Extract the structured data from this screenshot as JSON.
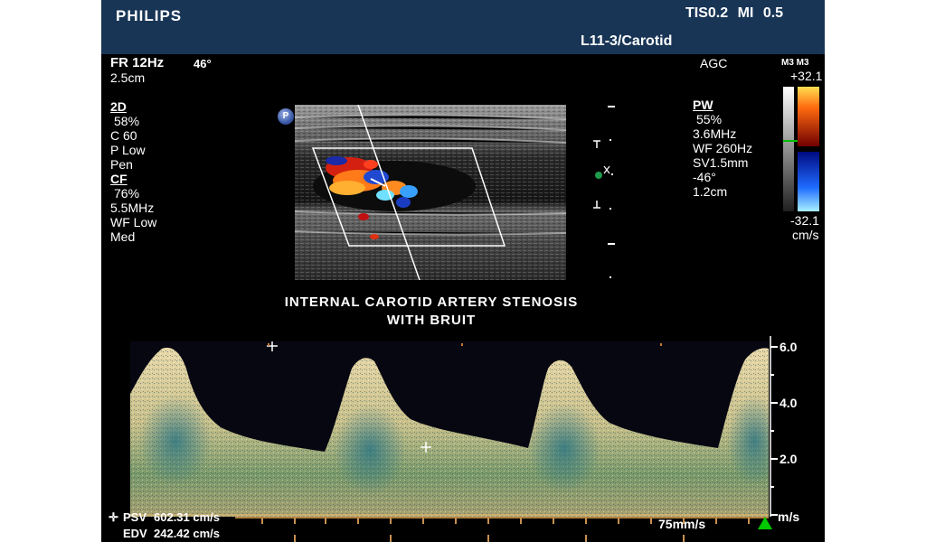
{
  "header": {
    "brand": "PHILIPS",
    "tis": "TIS0.2",
    "mi": "MI 0.5",
    "probe_preset": "L11-3/Carotid"
  },
  "left_panel": {
    "frame_rate": "FR 12Hz",
    "angle": "46°",
    "depth": "2.5cm",
    "mode_2d_title": "2D",
    "mode_2d": [
      "58%",
      "C 60",
      "P Low",
      "Pen"
    ],
    "mode_cf_title": "CF",
    "mode_cf": [
      "76%",
      "5.5MHz",
      "WF Low",
      "Med"
    ]
  },
  "right_panel": {
    "agc": "AGC",
    "pw_title": "PW",
    "pw": [
      "55%",
      "3.6MHz",
      "WF 260Hz",
      "SV1.5mm",
      "-46°",
      "1.2cm"
    ]
  },
  "colorbar": {
    "header": "M3 M3",
    "top_value": "+32.1",
    "bottom_value": "-32.1",
    "unit": "cm/s"
  },
  "image": {
    "badge": "P",
    "caption_line1": "INTERNAL CAROTID ARTERY STENOSIS",
    "caption_line2": "WITH BRUIT"
  },
  "doppler": {
    "scale_labels": [
      "6.0",
      "4.0",
      "2.0"
    ],
    "unit": "m/s",
    "sweep_speed": "75mm/s",
    "psv_label": "PSV",
    "psv_value": "602.31 cm/s",
    "edv_label": "EDV",
    "edv_value": "242.42 cm/s"
  },
  "colors": {
    "header_bg": "#183556",
    "trigger_marker": "#00c800",
    "spectrum_tint": "#d9c79a"
  }
}
